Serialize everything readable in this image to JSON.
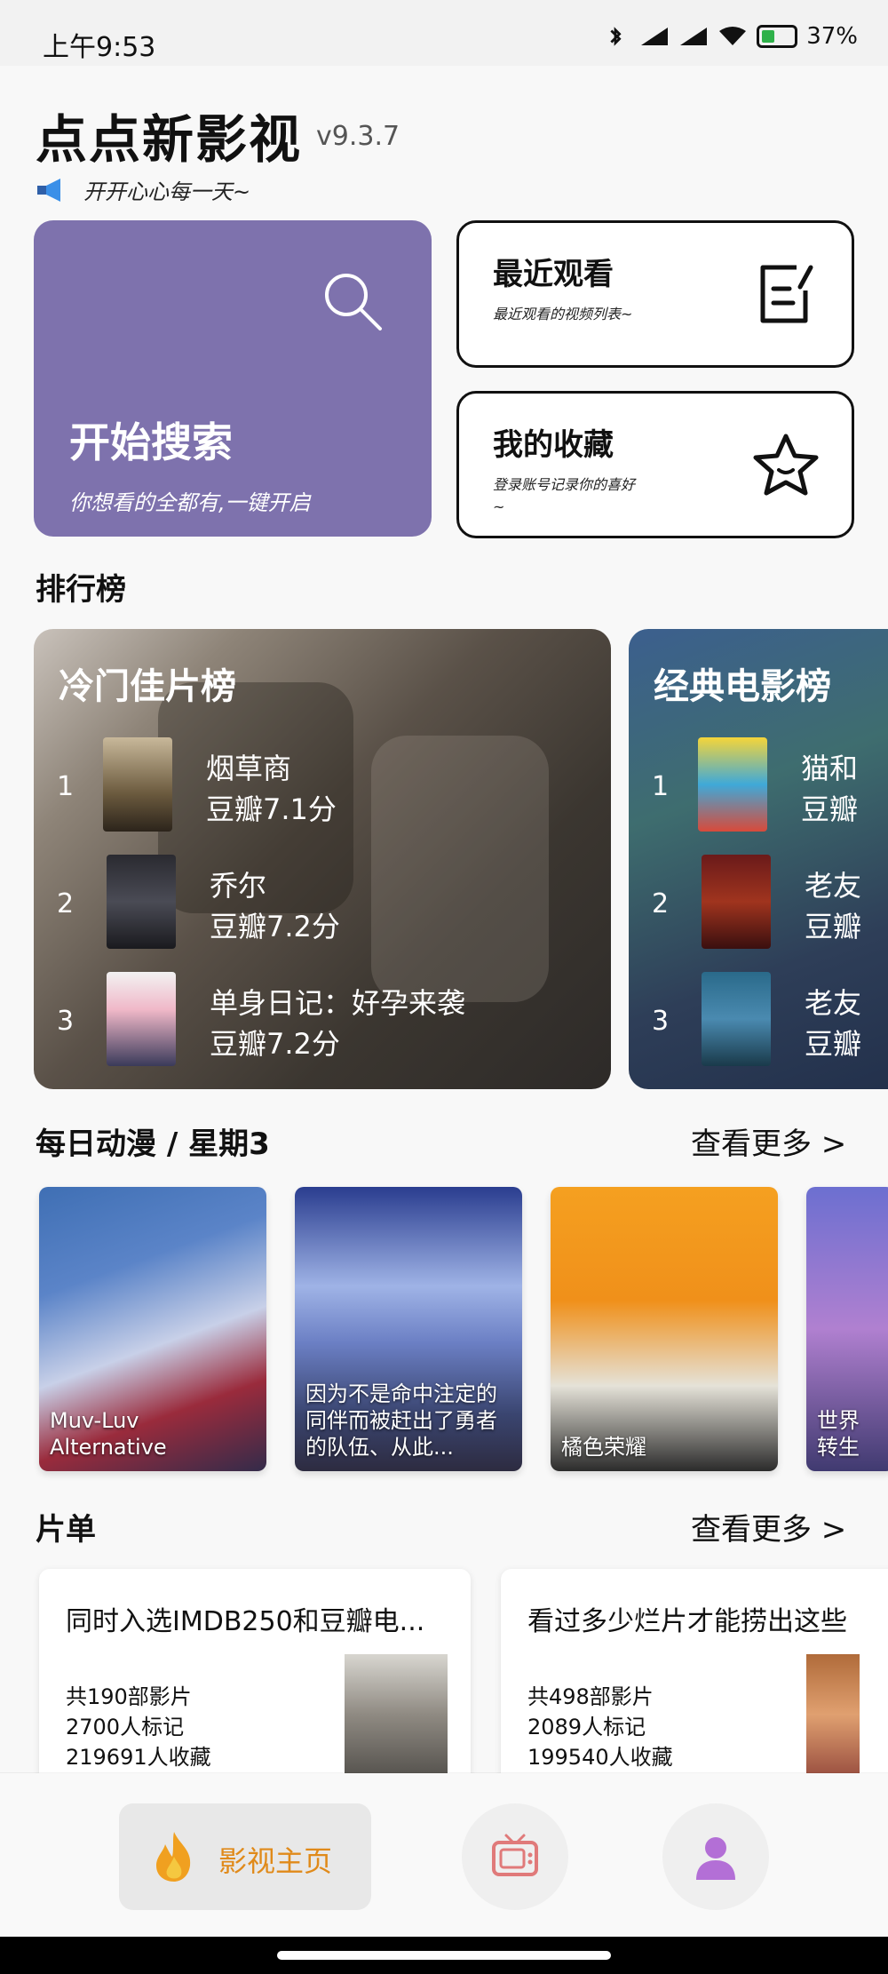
{
  "status_bar": {
    "time": "上午9:53",
    "battery": "37%"
  },
  "header": {
    "title": "点点新影视",
    "version": "v9.3.7",
    "notice": "开开心心每一天~"
  },
  "quick": {
    "search": {
      "title": "开始搜索",
      "subtitle": "你想看的全都有,一键开启"
    },
    "recent": {
      "title": "最近观看",
      "subtitle": "最近观看的视频列表~"
    },
    "favorites": {
      "title": "我的收藏",
      "subtitle": "登录账号记录你的喜好~"
    }
  },
  "rankings": {
    "title": "排行榜",
    "cards": [
      {
        "title": "冷门佳片榜",
        "items": [
          {
            "rank": "1",
            "name": "烟草商",
            "score": "豆瓣7.1分"
          },
          {
            "rank": "2",
            "name": "乔尔",
            "score": "豆瓣7.2分"
          },
          {
            "rank": "3",
            "name": "单身日记：好孕来袭",
            "score": "豆瓣7.2分"
          }
        ]
      },
      {
        "title": "经典电影榜",
        "items": [
          {
            "rank": "1",
            "name": "猫和",
            "score": "豆瓣"
          },
          {
            "rank": "2",
            "name": "老友",
            "score": "豆瓣"
          },
          {
            "rank": "3",
            "name": "老友",
            "score": "豆瓣"
          }
        ]
      }
    ]
  },
  "anime": {
    "title": "每日动漫 / 星期3",
    "more": "查看更多 >",
    "items": [
      {
        "caption": "Muv-Luv Alternative"
      },
      {
        "caption": "因为不是命中注定的同伴而被赶出了勇者的队伍、从此..."
      },
      {
        "caption": "橘色荣耀"
      },
      {
        "caption": "世界转生"
      }
    ]
  },
  "playlists": {
    "title": "片单",
    "more": "查看更多 >",
    "items": [
      {
        "title": "同时入选IMDB250和豆瓣电...",
        "films": "共190部影片",
        "marked": "2700人标记",
        "saved": "219691人收藏"
      },
      {
        "title": "看过多少烂片才能捞出这些",
        "films": "共498部影片",
        "marked": "2089人标记",
        "saved": "199540人收藏"
      }
    ]
  },
  "nav": {
    "home_label": "影视主页"
  },
  "colors": {
    "search_card": "#7e72ad",
    "nav_active": "#e08a1a",
    "user_icon": "#b36fd6",
    "tv_icon": "#e07a7a"
  }
}
